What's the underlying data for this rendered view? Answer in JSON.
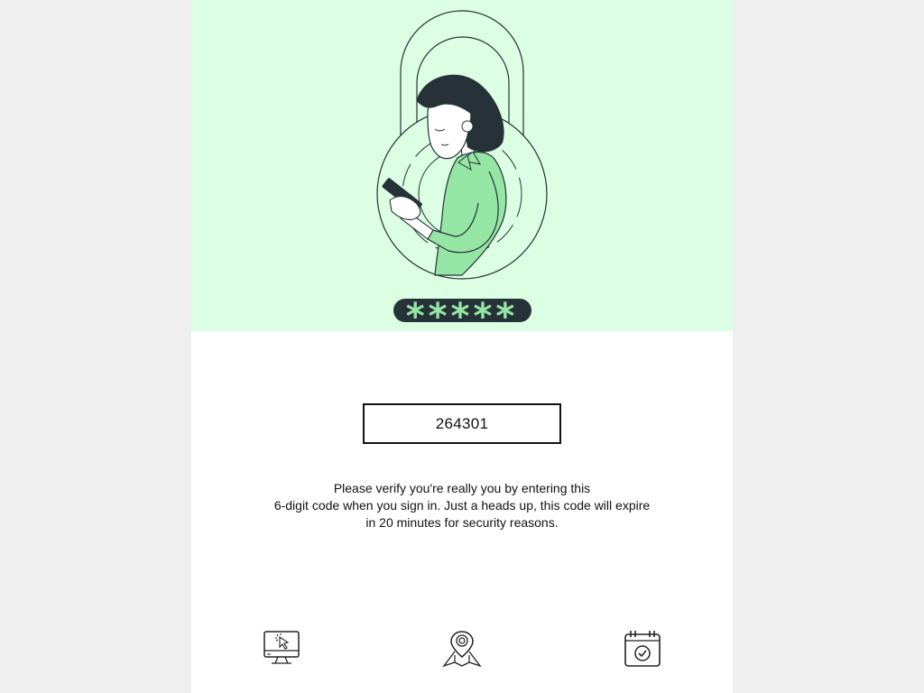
{
  "colors": {
    "hero_background": "#dcfee2",
    "accent_green": "#95e5a4",
    "ink": "#263238",
    "page_background": "#efefef"
  },
  "hero": {
    "illustration": "woman-with-phone-padlock",
    "password_mask": "*****"
  },
  "verification": {
    "code": "264301",
    "message_lines": [
      "Please verify you're really you by entering this",
      "6-digit code when you sign in. Just a heads up, this code will expire",
      "in 20 minutes for security reasons."
    ]
  },
  "footer": {
    "icons": [
      "computer-click-icon",
      "map-pin-icon",
      "calendar-check-icon"
    ]
  }
}
